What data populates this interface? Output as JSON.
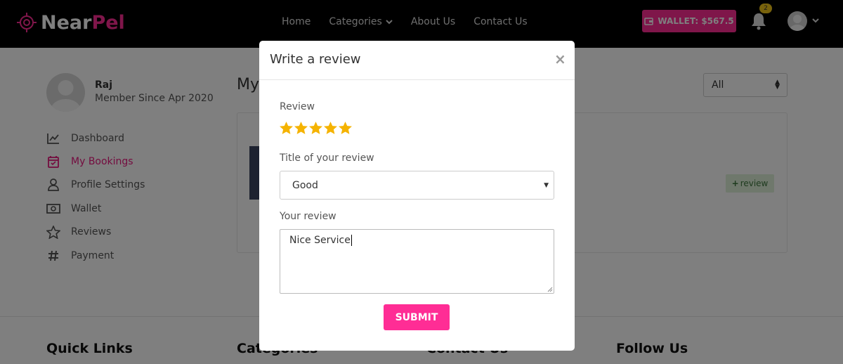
{
  "brand": {
    "name_part1": "Near",
    "name_part2": "Pel",
    "accent": "#ff2d95"
  },
  "nav": {
    "items": [
      {
        "label": "Home"
      },
      {
        "label": "Categories"
      },
      {
        "label": "About Us"
      },
      {
        "label": "Contact Us"
      }
    ]
  },
  "wallet": {
    "label": "WALLET: $567.5"
  },
  "notifications": {
    "count": "2"
  },
  "profile": {
    "name": "Raj",
    "since": "Member Since Apr 2020"
  },
  "sidebar": {
    "items": [
      {
        "label": "Dashboard",
        "icon": "chart-icon"
      },
      {
        "label": "My Bookings",
        "icon": "calendar-check-icon",
        "active": true
      },
      {
        "label": "Profile Settings",
        "icon": "user-icon"
      },
      {
        "label": "Wallet",
        "icon": "money-icon"
      },
      {
        "label": "Reviews",
        "icon": "star-outline-icon"
      },
      {
        "label": "Payment",
        "icon": "hash-icon"
      }
    ]
  },
  "main": {
    "title": "My",
    "filter_value": "All",
    "review_button": "review"
  },
  "footer": {
    "headings": [
      "Quick Links",
      "Categories",
      "Contact Us",
      "Follow Us"
    ]
  },
  "modal": {
    "title": "Write a review",
    "close": "×",
    "review_label": "Review",
    "rating": 5,
    "title_label": "Title of your review",
    "title_value": "Good",
    "text_label": "Your review",
    "text_value": "Nice Service",
    "submit": "SUBMIT"
  },
  "colors": {
    "star": "#f5b301",
    "active": "#e8187e"
  }
}
